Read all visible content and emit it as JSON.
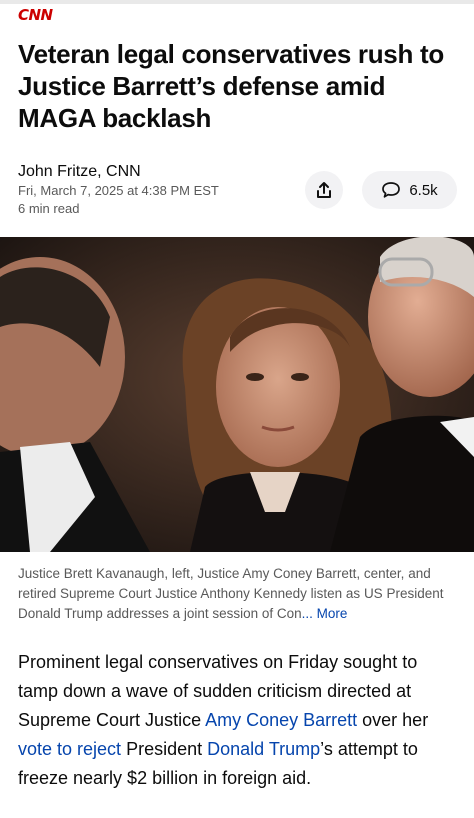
{
  "brand": {
    "logo": "CNN"
  },
  "article": {
    "headline": "Veteran legal conservatives rush to Justice Barrett’s defense amid MAGA backlash",
    "author": "John Fritze, CNN",
    "date": "Fri, March 7, 2025 at 4:38 PM EST",
    "read_time": "6 min read",
    "comment_count": "6.5k",
    "caption": "Justice Brett Kavanaugh, left, Justice Amy Coney Barrett, center, and retired Supreme Court Justice Anthony Kennedy listen as US President Donald Trump addresses a joint session of Con",
    "caption_more": "... More",
    "body": {
      "p1": "Prominent legal conservatives on Friday sought to tamp down a wave of sudden criticism directed at Supreme Court Justice ",
      "link1": "Amy Coney Barrett",
      "p2": " over her ",
      "link2": "vote to reject",
      "p3": " President ",
      "link3": "Donald Trump",
      "p4": "’s attempt to freeze nearly $2 billion in foreign aid."
    }
  },
  "icons": {
    "share": "share-icon",
    "comment": "comment-icon"
  },
  "colors": {
    "brand_red": "#cc0000",
    "link_blue": "#0645ad"
  }
}
